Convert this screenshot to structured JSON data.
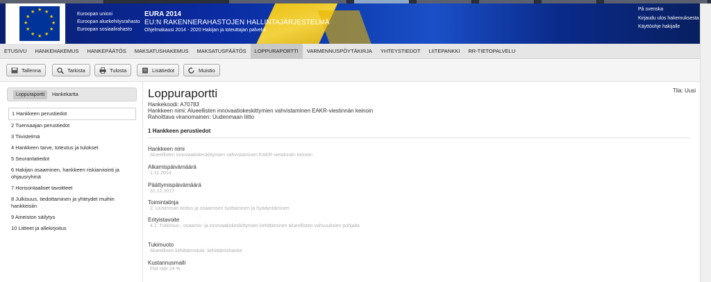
{
  "header": {
    "eu_lines": [
      "Euroopan unioni",
      "Euroopan aluekehitysrahasto",
      "Euroopan sosiaalirahasto"
    ],
    "app_title": "EURA 2014",
    "app_subtitle": "EU:N RAKENNERAHASTOJEN HALLINTAJÄRJESTELMÄ",
    "app_program": "Ohjelmakausi 2014 - 2020 Hakijan ja toteuttajan palvelut",
    "links": [
      "På svenska",
      "Kirjaudu ulos hakemuksesta",
      "Käyttöohje hakijalle"
    ]
  },
  "nav": {
    "items": [
      "ETUSIVU",
      "HANKEHAKEMUS",
      "HANKEPÄÄTÖS",
      "MAKSATUSHAKEMUS",
      "MAKSATUSPÄÄTÖS",
      "LOPPURAPORTTI",
      "VARMENNUSPÖYTÄKIRJA",
      "YHTEYSTIEDOT",
      "LIITEPANKKI",
      "RR-TIETOPALVELU"
    ],
    "active_index": 5
  },
  "toolbar": {
    "save": "Tallenna",
    "check": "Tarkista",
    "print": "Tulosta",
    "more_info": "Lisätiedot",
    "reminder": "Muistio"
  },
  "sidebar": {
    "tabs": [
      "Loppuraportti",
      "Hankekartta"
    ],
    "items": [
      "1 Hankkeen perustiedot",
      "2 Tuensaajan perustiedot",
      "3 Tiivistelmä",
      "4 Hankkeen tarve, toteutus ja tulokset",
      "5 Seurantatiedot",
      "6 Hakijan osaaminen, hankkeen riskiarviointi ja ohjausryhmä",
      "7 Horisontaaliset tavoitteet",
      "8 Julkisuus, tiedottaminen ja yhteydet muihin hankkeisiin",
      "9 Aineiston säilytys",
      "10 Liitteet ja allekirjoitus"
    ]
  },
  "main": {
    "title": "Loppuraportti",
    "status": "Tila: Uusi",
    "code": "Hankekoodi: A70783",
    "name": "Hankkeen nimi: Alueellisten innovaatiokeskittymien vahvistaminen EAKR-viestinnän keinoin",
    "authority": "Rahoittava viranomainen: Uudenmaan liitto",
    "section": "1 Hankkeen perustiedot",
    "fields": [
      {
        "label": "Hankkeen nimi",
        "value": "Alueellisten innovaatiokeskittymien vahvistaminen EAKR-viestinnän keinoin"
      },
      {
        "label": "Alkamispäivämäärä",
        "value": "1.11.2014"
      },
      {
        "label": "Päättymispäivämäärä",
        "value": "31.12.2017"
      },
      {
        "label": "Toimintalinja",
        "value": "2. Uusimman tiedon ja osaamisen tuottaminen ja hyödyntäminen"
      },
      {
        "label": "Erityistavoite",
        "value": "4.1. Tutkimus-, osaamis- ja innovaatiokeskittymien kehittäminen alueellisten vahvuuksien pohjalta"
      },
      {
        "label": "Tukimuoto",
        "value": "Alueellinen kehittämistuki: kehittämishanke"
      },
      {
        "label": "Kustannusmalli",
        "value": "Flat rate 24 %"
      }
    ]
  }
}
